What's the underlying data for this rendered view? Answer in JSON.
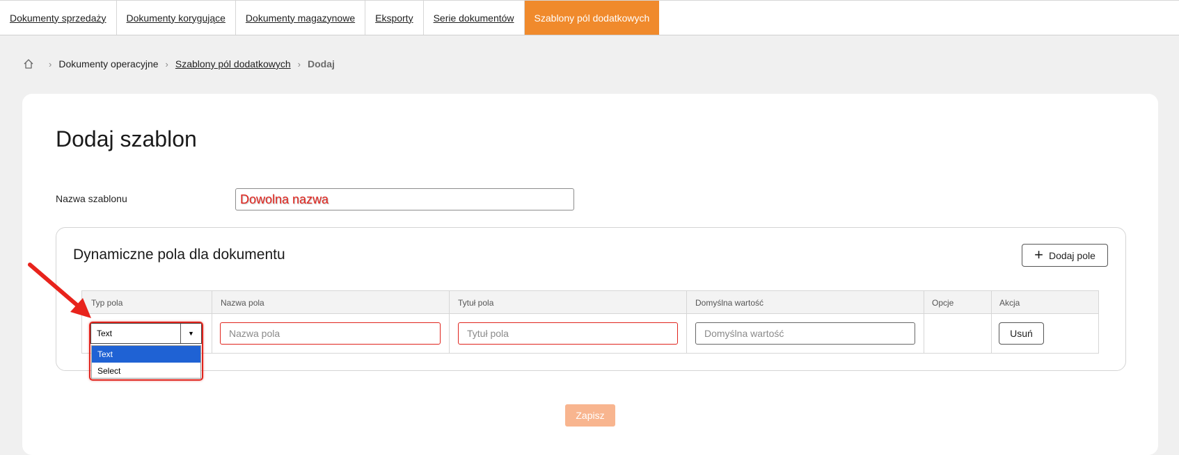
{
  "top_tabs": [
    {
      "label": "Dokumenty sprzedaży"
    },
    {
      "label": "Dokumenty korygujące"
    },
    {
      "label": "Dokumenty magazynowe"
    },
    {
      "label": "Eksporty"
    },
    {
      "label": "Serie dokumentów"
    },
    {
      "label": "Szablony pól dodatkowych",
      "active": true
    }
  ],
  "breadcrumb": {
    "home_icon": "home-icon",
    "items": [
      "Dokumenty operacyjne",
      "Szablony pól dodatkowych",
      "Dodaj"
    ],
    "separator": "›"
  },
  "form": {
    "title": "Dodaj szablon",
    "name_label": "Nazwa szablonu",
    "name_value": "Dowolna nazwa"
  },
  "fields_panel": {
    "title": "Dynamiczne pola dla dokumentu",
    "add_button": "Dodaj pole",
    "add_icon": "plus-icon",
    "columns": [
      "Typ pola",
      "Nazwa pola",
      "Tytuł pola",
      "Domyślna wartość",
      "Opcje",
      "Akcja"
    ],
    "row": {
      "type_value": "Text",
      "name_placeholder": "Nazwa pola",
      "title_placeholder": "Tytuł pola",
      "default_placeholder": "Domyślna wartość",
      "remove_button": "Usuń"
    },
    "type_options": [
      {
        "label": "Text",
        "selected": true
      },
      {
        "label": "Select",
        "selected": false
      }
    ]
  },
  "save_button": "Zapisz",
  "colors": {
    "accent": "#f08a2c",
    "save_disabled": "#f8b58f",
    "error_border": "#e0231c",
    "dropdown_selected": "#1f62d4"
  }
}
